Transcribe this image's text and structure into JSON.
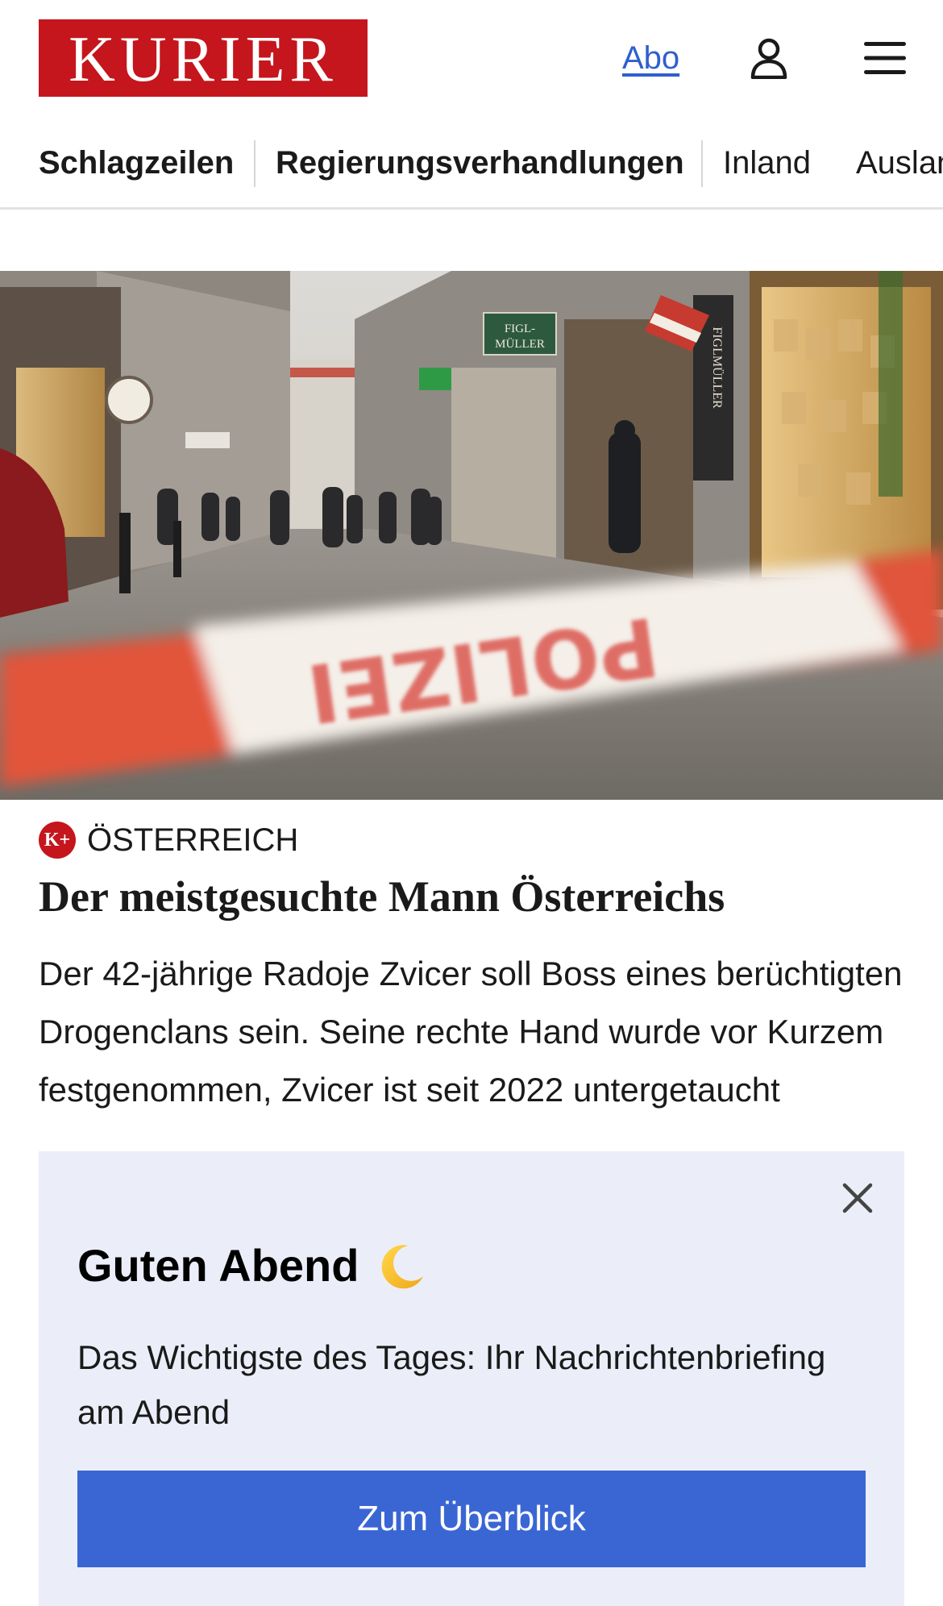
{
  "header": {
    "logo_text": "KURIER",
    "abo_label": "Abo",
    "user_icon": "user-icon",
    "menu_icon": "hamburger-menu-icon"
  },
  "nav": {
    "items": [
      {
        "label": "Schlagzeilen",
        "bold": true
      },
      {
        "label": "Regierungsverhandlungen",
        "bold": true
      },
      {
        "label": "Inland",
        "bold": false
      },
      {
        "label": "Ausland",
        "bold": false
      }
    ]
  },
  "article": {
    "hero_image": {
      "description_icon": "news-photo",
      "tape_text": "POLIZEI",
      "sign_text_1": "FIGL-MÜLLER",
      "sign_text_2": "FIGLMÜLLER"
    },
    "kicker_badge": "K+",
    "kicker": "ÖSTERREICH",
    "headline": "Der meistgesuchte Mann Österreichs",
    "teaser": "Der 42-jährige Radoje Zvicer soll Boss eines berüchtigten Drogenclans sein. Seine rechte Hand wurde vor Kurzem festgenommen, Zvicer ist seit 2022 untergetaucht"
  },
  "popup": {
    "title": "Guten Abend",
    "title_icon": "crescent-moon-icon",
    "text": "Das Wichtigste des Tages: Ihr Nachrichtenbriefing am Abend",
    "button_label": "Zum Überblick",
    "close_icon": "close-icon"
  },
  "colors": {
    "brand_red": "#c4161c",
    "link_blue": "#2f5fd0",
    "button_blue": "#3a66d4",
    "popup_bg": "#ebeef8"
  }
}
